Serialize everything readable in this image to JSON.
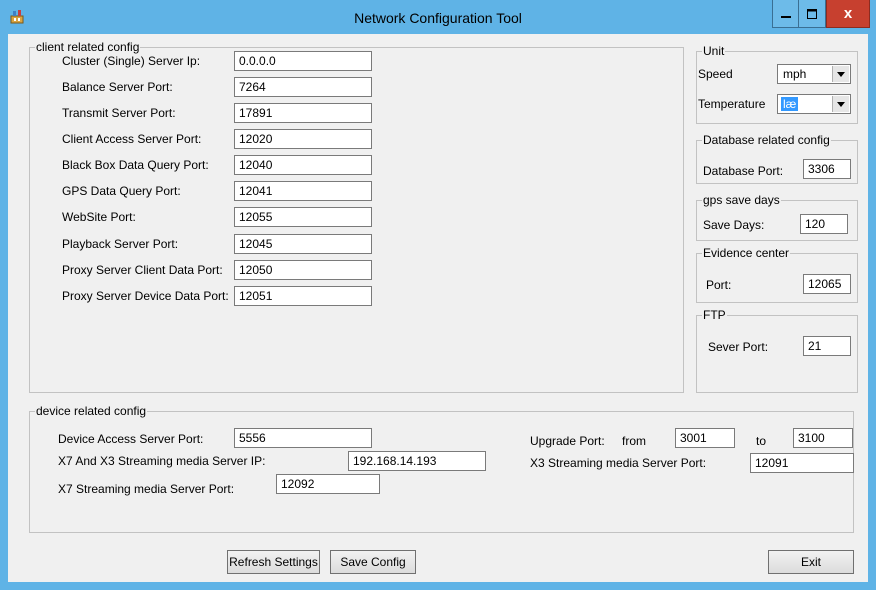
{
  "window": {
    "title": "Network Configuration Tool",
    "close_label": "x"
  },
  "client_group": {
    "legend": "client related config",
    "rows": [
      {
        "label": "Cluster (Single) Server Ip:",
        "value": "0.0.0.0"
      },
      {
        "label": "Balance Server Port:",
        "value": "7264"
      },
      {
        "label": "Transmit Server Port:",
        "value": "17891"
      },
      {
        "label": "Client Access Server Port:",
        "value": "12020"
      },
      {
        "label": "Black Box Data Query Port:",
        "value": "12040"
      },
      {
        "label": "GPS Data Query Port:",
        "value": "12041"
      },
      {
        "label": "WebSite Port:",
        "value": "12055"
      },
      {
        "label": "Playback Server Port:",
        "value": "12045"
      },
      {
        "label": "Proxy Server Client Data Port:",
        "value": "12050"
      },
      {
        "label": "Proxy Server Device Data Port:",
        "value": "12051"
      }
    ]
  },
  "unit_group": {
    "legend": "Unit",
    "speed_label": "Speed",
    "speed_value": "mph",
    "temperature_label": "Temperature",
    "temperature_value": "læ"
  },
  "database_group": {
    "legend": "Database related config",
    "port_label": "Database Port:",
    "port_value": "3306"
  },
  "gps_group": {
    "legend": "gps save days",
    "days_label": "Save Days:",
    "days_value": "120"
  },
  "evidence_group": {
    "legend": "Evidence center",
    "port_label": "Port:",
    "port_value": "12065"
  },
  "ftp_group": {
    "legend": "FTP",
    "port_label": "Sever Port:",
    "port_value": "21"
  },
  "device_group": {
    "legend": "device related config",
    "access_label": "Device Access Server Port:",
    "access_value": "5556",
    "x7x3_ip_label": "X7 And X3 Streaming media Server IP:",
    "x7x3_ip_value": "192.168.14.193",
    "x7_port_label": "X7 Streaming media Server Port:",
    "x7_port_value": "12092",
    "upgrade_label": "Upgrade Port:",
    "from_label": "from",
    "from_value": "3001",
    "to_label": "to",
    "to_value": "3100",
    "x3_port_label": "X3 Streaming media Server Port:",
    "x3_port_value": "12091"
  },
  "buttons": {
    "refresh": "Refresh Settings",
    "save": "Save Config",
    "exit": "Exit"
  }
}
